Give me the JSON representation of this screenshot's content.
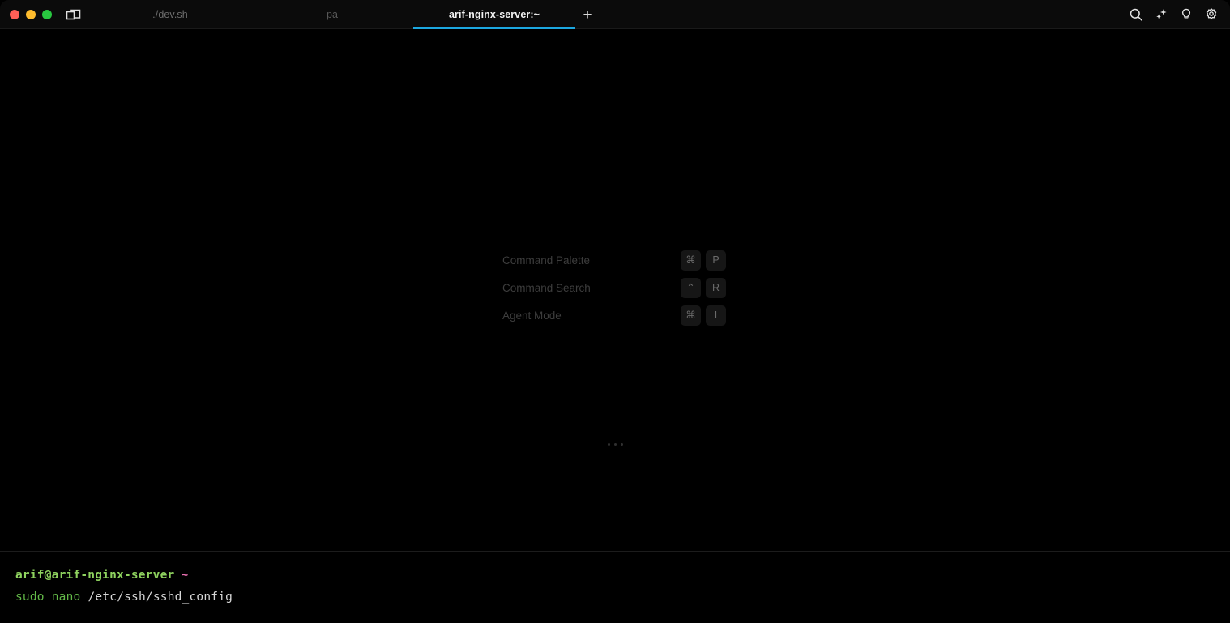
{
  "window": {
    "traffic_lights": [
      {
        "name": "close",
        "color": "#ff5f57"
      },
      {
        "name": "minimize",
        "color": "#febc2e"
      },
      {
        "name": "maximize",
        "color": "#28c840"
      }
    ],
    "accent_color": "#1ca7e0",
    "background": "#000000"
  },
  "tabbar": {
    "split_pane_icon": "split-pane-icon",
    "new_tab_label": "+",
    "tabs": [
      {
        "label": "./dev.sh",
        "active": false
      },
      {
        "label": "pa",
        "active": false
      },
      {
        "label": "arif-nginx-server:~",
        "active": true
      }
    ],
    "right_icons": [
      {
        "name": "search-icon"
      },
      {
        "name": "sparkle-icon"
      },
      {
        "name": "lightbulb-icon"
      },
      {
        "name": "gear-icon"
      }
    ]
  },
  "hints": {
    "rows": [
      {
        "label": "Command Palette",
        "keys": [
          "⌘",
          "P"
        ]
      },
      {
        "label": "Command Search",
        "keys": [
          "⌃",
          "R"
        ]
      },
      {
        "label": "Agent Mode",
        "keys": [
          "⌘",
          "I"
        ]
      }
    ],
    "overflow_indicator": "..."
  },
  "prompt": {
    "user_host": "arif@arif-nginx-server",
    "cwd": "~",
    "command": "sudo",
    "subcommand": "nano",
    "argument": "/etc/ssh/sshd_config",
    "prompt_color": "#8fd35f",
    "cwd_color": "#e86fb0",
    "command_color": "#63b948",
    "argument_color": "#d6d6d6"
  }
}
